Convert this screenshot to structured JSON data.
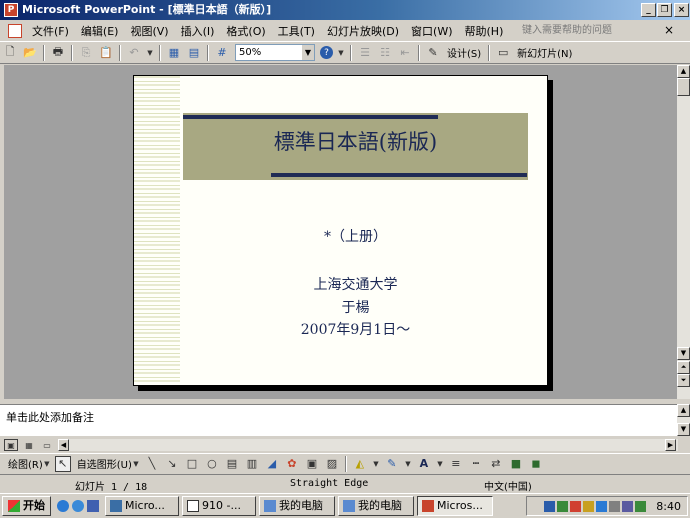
{
  "window": {
    "app": "Microsoft PowerPoint",
    "title": "Microsoft PowerPoint - [標準日本語（新版）]"
  },
  "menu": [
    "文件(F)",
    "编辑(E)",
    "视图(V)",
    "插入(I)",
    "格式(O)",
    "工具(T)",
    "幻灯片放映(D)",
    "窗口(W)",
    "帮助(H)"
  ],
  "help_placeholder": "键入需要帮助的问题",
  "toolbar": {
    "zoom": "50%",
    "design_label": "设计(S)",
    "new_slide_label": "新幻灯片(N)"
  },
  "slide": {
    "title": "標準日本語(新版)",
    "subtitle": "*（上册）",
    "lines": [
      "上海交通大学",
      "于楊",
      "2007年9月1日～"
    ]
  },
  "notes_placeholder": "单击此处添加备注",
  "drawbar": {
    "draw_label": "绘图(R)",
    "autoshape_label": "自选图形(U)"
  },
  "status": {
    "slide": "幻灯片 1 / 18",
    "design": "Straight Edge",
    "language": "中文(中国)"
  },
  "taskbar": {
    "start": "开始",
    "tasks": [
      "Micro...",
      "910 -...",
      "我的电脑",
      "我的电脑",
      "Micros..."
    ],
    "clock": "8:40"
  },
  "colors": {
    "title_band": "#a8a882",
    "title_text": "#1a2754",
    "titlebar": "#0a246a"
  }
}
